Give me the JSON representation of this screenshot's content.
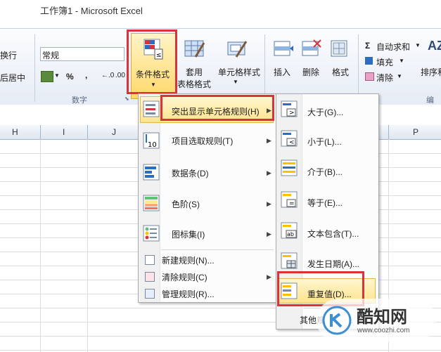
{
  "window": {
    "title": "工作簿1 - Microsoft Excel"
  },
  "ribbon": {
    "wrap_text": "换行",
    "merge_center": "后居中",
    "number_format": "常规",
    "percent": "%",
    "comma": ",",
    "number_group": "数字",
    "conditional_formatting": "条件格式",
    "format_as_table_1": "套用",
    "format_as_table_2": "表格格式",
    "cell_styles": "单元格样式",
    "insert": "插入",
    "delete": "删除",
    "format": "格式",
    "autosum": "自动求和",
    "fill": "填充",
    "clear": "清除",
    "sort_filter": "排序和",
    "edit_group": "编辑"
  },
  "columns": [
    "H",
    "I",
    "J",
    "P"
  ],
  "menu": {
    "items": [
      {
        "label": "突出显示单元格规则(H)",
        "hotkey": "H"
      },
      {
        "label": "项目选取规则(T)",
        "hotkey": "T"
      },
      {
        "label": "数据条(D)",
        "hotkey": "D"
      },
      {
        "label": "色阶(S)",
        "hotkey": "S"
      },
      {
        "label": "图标集(I)",
        "hotkey": "I"
      },
      {
        "label": "新建规则(N)..."
      },
      {
        "label": "清除规则(C)"
      },
      {
        "label": "管理规则(R)..."
      }
    ]
  },
  "submenu": {
    "items": [
      {
        "label": "大于(G)..."
      },
      {
        "label": "小于(L)..."
      },
      {
        "label": "介于(B)..."
      },
      {
        "label": "等于(E)..."
      },
      {
        "label": "文本包含(T)..."
      },
      {
        "label": "发生日期(A)..."
      },
      {
        "label": "重复值(D)..."
      },
      {
        "label": "其他规则(M)..."
      }
    ]
  },
  "watermark": {
    "name": "酷知网",
    "url": "www.coozhi.com"
  },
  "colors": {
    "highlight_red": "#d9323a",
    "menu_hover": "#ffe48c",
    "ribbon_bg": "#e6ecf5"
  }
}
